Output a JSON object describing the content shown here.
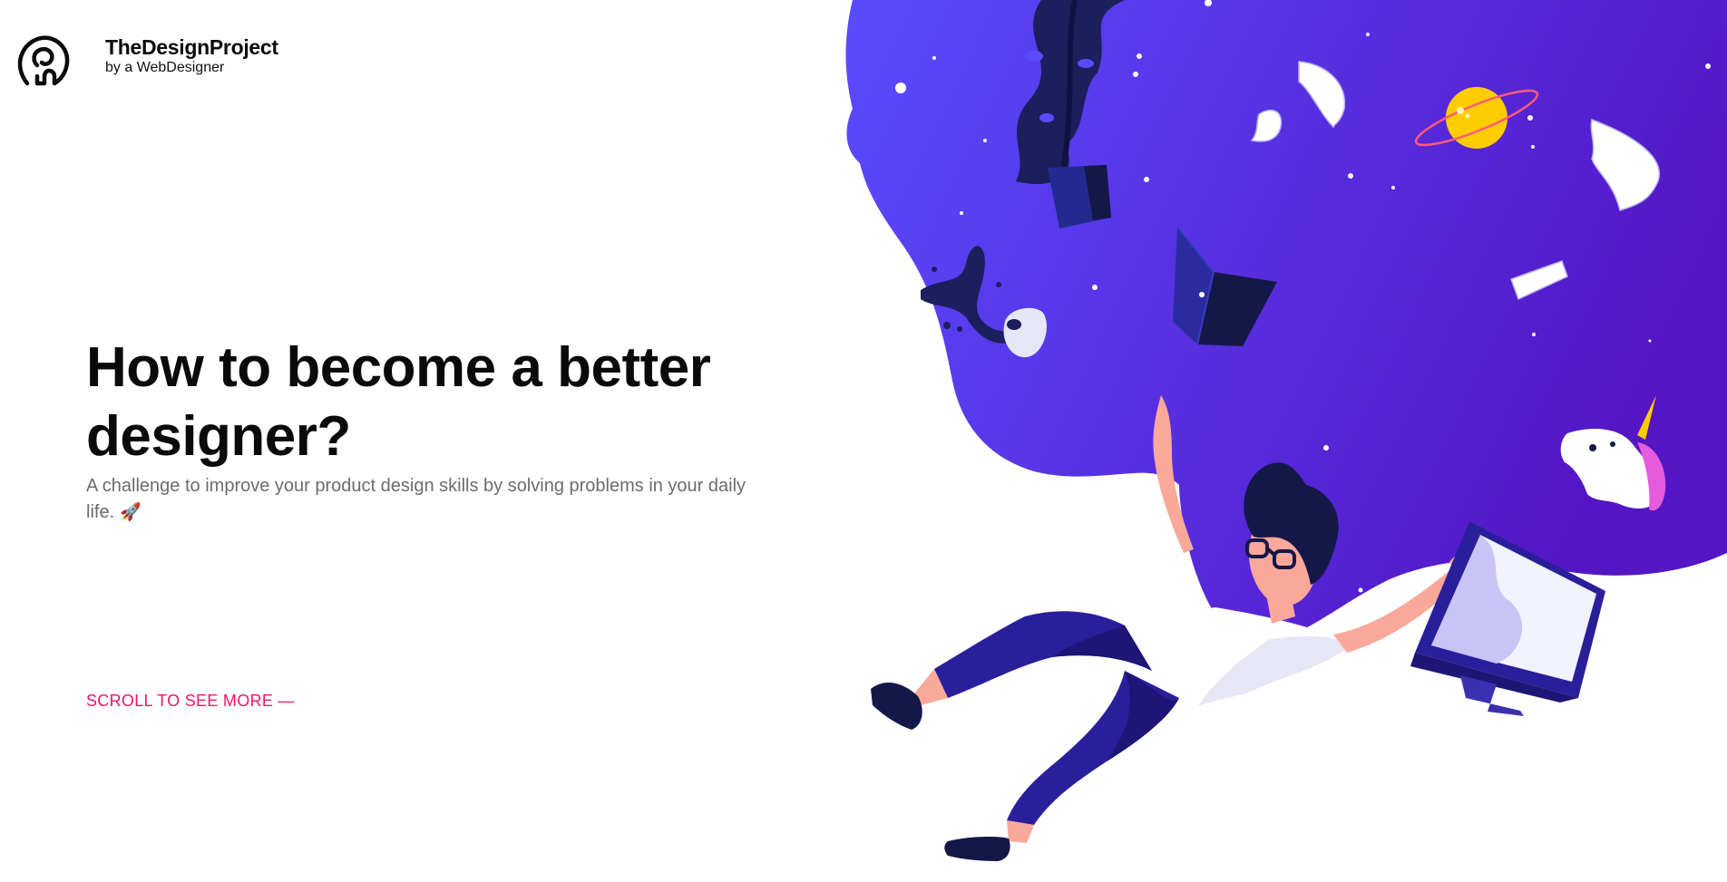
{
  "brand": {
    "name": "TheDesignProject",
    "tagline": "by a WebDesigner",
    "logo_icon": "elephant-head-logo-icon"
  },
  "hero": {
    "title": "How to become a better designer?",
    "subtitle": "A challenge to improve your product design skills by solving problems in your daily life.",
    "subtitle_emoji": "🚀",
    "cta_label": "SCROLL TO SEE MORE —"
  },
  "illustration": {
    "scene": "designer-floating-in-space-illustration",
    "colors": {
      "space_start": "#5a4bff",
      "space_end": "#5416c4",
      "skin": "#f9a89a",
      "pants": "#2a1f9b",
      "dark": "#141848",
      "planet": "#ffcc00",
      "cta": "#f01465"
    }
  }
}
